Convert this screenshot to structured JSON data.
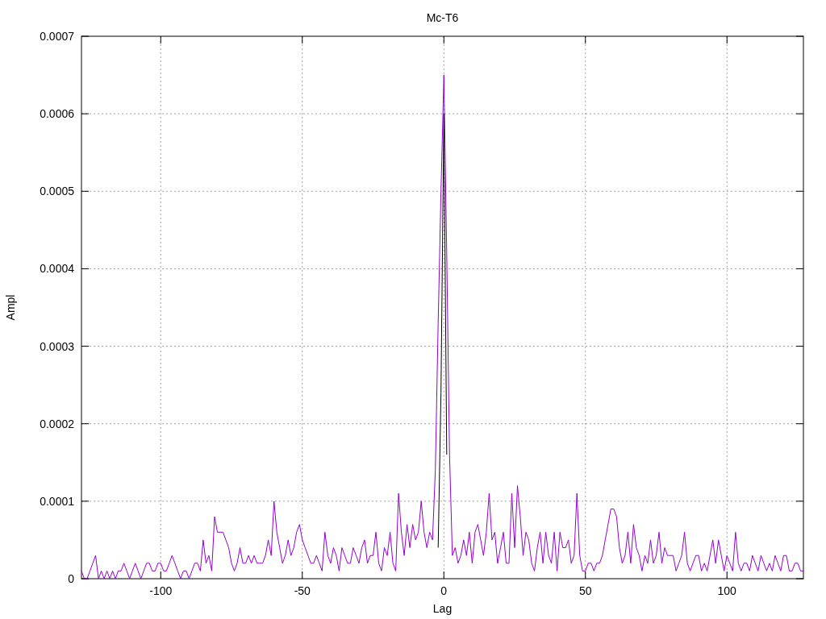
{
  "chart_data": {
    "type": "line",
    "title": "Mc-T6",
    "xlabel": "Lag",
    "ylabel": "Ampl",
    "grid": true,
    "xlim": [
      -128,
      127
    ],
    "ylim": [
      0,
      0.0007
    ],
    "xticks": [
      -100,
      -50,
      0,
      50,
      100
    ],
    "yticks": [
      {
        "value": 0,
        "label": "0"
      },
      {
        "value": 0.0001,
        "label": "0.0001"
      },
      {
        "value": 0.0002,
        "label": "0.0002"
      },
      {
        "value": 0.0003,
        "label": "0.0003"
      },
      {
        "value": 0.0004,
        "label": "0.0004"
      },
      {
        "value": 0.0005,
        "label": "0.0005"
      },
      {
        "value": 0.0006,
        "label": "0.0006"
      },
      {
        "value": 0.0007,
        "label": "0.0007"
      }
    ],
    "x": [
      -128,
      -127,
      -126,
      -125,
      -124,
      -123,
      -122,
      -121,
      -120,
      -119,
      -118,
      -117,
      -116,
      -115,
      -114,
      -113,
      -112,
      -111,
      -110,
      -109,
      -108,
      -107,
      -106,
      -105,
      -104,
      -103,
      -102,
      -101,
      -100,
      -99,
      -98,
      -97,
      -96,
      -95,
      -94,
      -93,
      -92,
      -91,
      -90,
      -89,
      -88,
      -87,
      -86,
      -85,
      -84,
      -83,
      -82,
      -81,
      -80,
      -79,
      -78,
      -77,
      -76,
      -75,
      -74,
      -73,
      -72,
      -71,
      -70,
      -69,
      -68,
      -67,
      -66,
      -65,
      -64,
      -63,
      -62,
      -61,
      -60,
      -59,
      -58,
      -57,
      -56,
      -55,
      -54,
      -53,
      -52,
      -51,
      -50,
      -49,
      -48,
      -47,
      -46,
      -45,
      -44,
      -43,
      -42,
      -41,
      -40,
      -39,
      -38,
      -37,
      -36,
      -35,
      -34,
      -33,
      -32,
      -31,
      -30,
      -29,
      -28,
      -27,
      -26,
      -25,
      -24,
      -23,
      -22,
      -21,
      -20,
      -19,
      -18,
      -17,
      -16,
      -15,
      -14,
      -13,
      -12,
      -11,
      -10,
      -9,
      -8,
      -7,
      -6,
      -5,
      -4,
      -3,
      -2,
      -1,
      0,
      1,
      2,
      3,
      4,
      5,
      6,
      7,
      8,
      9,
      10,
      11,
      12,
      13,
      14,
      15,
      16,
      17,
      18,
      19,
      20,
      21,
      22,
      23,
      24,
      25,
      26,
      27,
      28,
      29,
      30,
      31,
      32,
      33,
      34,
      35,
      36,
      37,
      38,
      39,
      40,
      41,
      42,
      43,
      44,
      45,
      46,
      47,
      48,
      49,
      50,
      51,
      52,
      53,
      54,
      55,
      56,
      57,
      58,
      59,
      60,
      61,
      62,
      63,
      64,
      65,
      66,
      67,
      68,
      69,
      70,
      71,
      72,
      73,
      74,
      75,
      76,
      77,
      78,
      79,
      80,
      81,
      82,
      83,
      84,
      85,
      86,
      87,
      88,
      89,
      90,
      91,
      92,
      93,
      94,
      95,
      96,
      97,
      98,
      99,
      100,
      101,
      102,
      103,
      104,
      105,
      106,
      107,
      108,
      109,
      110,
      111,
      112,
      113,
      114,
      115,
      116,
      117,
      118,
      119,
      120,
      121,
      122,
      123,
      124,
      125,
      126,
      127
    ],
    "series": [
      {
        "color": "#000000",
        "values": [
          null,
          null,
          null,
          null,
          null,
          null,
          null,
          null,
          null,
          null,
          null,
          null,
          null,
          null,
          null,
          null,
          null,
          null,
          null,
          null,
          null,
          null,
          null,
          null,
          null,
          null,
          null,
          null,
          null,
          null,
          null,
          null,
          null,
          null,
          null,
          null,
          null,
          null,
          null,
          null,
          null,
          null,
          null,
          null,
          null,
          null,
          null,
          null,
          null,
          null,
          null,
          null,
          null,
          null,
          null,
          null,
          null,
          null,
          null,
          null,
          null,
          null,
          null,
          null,
          null,
          null,
          null,
          null,
          null,
          null,
          null,
          null,
          null,
          null,
          null,
          null,
          null,
          null,
          null,
          null,
          null,
          null,
          null,
          null,
          null,
          null,
          null,
          null,
          null,
          null,
          null,
          null,
          null,
          null,
          null,
          null,
          null,
          null,
          null,
          null,
          null,
          null,
          null,
          null,
          null,
          null,
          null,
          null,
          null,
          null,
          null,
          null,
          null,
          null,
          null,
          null,
          null,
          null,
          null,
          null,
          null,
          null,
          null,
          null,
          null,
          null,
          4e-05,
          0.00024,
          0.0006,
          0.00016,
          null,
          null,
          null,
          null,
          null,
          null,
          null,
          null,
          null,
          null,
          null,
          null,
          null,
          null,
          null,
          null,
          null,
          null,
          null,
          null,
          null,
          null,
          null,
          null,
          null,
          null,
          null,
          null,
          null,
          null,
          null,
          null,
          null,
          null,
          null,
          null,
          null,
          null,
          null,
          null,
          null,
          null,
          null,
          null,
          null,
          null,
          null,
          null,
          null,
          null,
          null,
          null,
          null,
          null,
          null,
          null,
          null,
          null,
          null,
          null,
          null,
          null,
          null,
          null,
          null,
          null,
          null,
          null,
          null,
          null,
          null,
          null,
          null,
          null,
          null,
          null,
          null,
          null,
          null,
          null,
          null,
          null,
          null,
          null,
          null,
          null,
          null,
          null,
          null,
          null,
          null,
          null,
          null,
          null,
          null,
          null,
          null,
          null,
          null,
          null,
          null,
          null,
          null,
          null,
          null,
          null,
          null,
          null,
          null,
          null,
          null,
          null,
          null,
          null,
          null,
          null,
          null,
          null,
          null,
          null,
          null,
          null,
          null,
          null,
          null,
          null
        ]
      },
      {
        "color": "#9400d3",
        "values": [
          1e-05,
          0,
          0,
          1e-05,
          2e-05,
          3e-05,
          0,
          1e-05,
          0,
          1e-05,
          0,
          1e-05,
          0,
          1e-05,
          1e-05,
          2e-05,
          1e-05,
          0,
          1e-05,
          2e-05,
          1e-05,
          0,
          1e-05,
          2e-05,
          2e-05,
          1e-05,
          1e-05,
          2e-05,
          2e-05,
          1e-05,
          1e-05,
          2e-05,
          3e-05,
          2e-05,
          1e-05,
          0,
          1e-05,
          1e-05,
          0,
          1e-05,
          2e-05,
          2e-05,
          1e-05,
          5e-05,
          2e-05,
          3e-05,
          1e-05,
          8e-05,
          6e-05,
          6e-05,
          6e-05,
          5e-05,
          4e-05,
          2e-05,
          1e-05,
          2e-05,
          4e-05,
          2e-05,
          2e-05,
          3e-05,
          2e-05,
          3e-05,
          2e-05,
          2e-05,
          2e-05,
          3e-05,
          5e-05,
          3e-05,
          0.0001,
          6e-05,
          4e-05,
          2e-05,
          3e-05,
          5e-05,
          3e-05,
          4e-05,
          6e-05,
          7e-05,
          5e-05,
          4e-05,
          3e-05,
          2e-05,
          2e-05,
          3e-05,
          2e-05,
          1e-05,
          6e-05,
          3e-05,
          2e-05,
          4e-05,
          3e-05,
          1e-05,
          4e-05,
          3e-05,
          2e-05,
          2e-05,
          4e-05,
          3e-05,
          2e-05,
          4e-05,
          5e-05,
          2e-05,
          3e-05,
          3e-05,
          6e-05,
          2e-05,
          1e-05,
          4e-05,
          3e-05,
          6e-05,
          2e-05,
          1e-05,
          0.00011,
          6e-05,
          3e-05,
          7e-05,
          4e-05,
          7e-05,
          5e-05,
          6e-05,
          0.0001,
          6e-05,
          4e-05,
          6e-05,
          5e-05,
          0.00014,
          0.00033,
          0.0005,
          0.00065,
          0.00042,
          0.00016,
          3e-05,
          4e-05,
          2e-05,
          3e-05,
          5e-05,
          3e-05,
          6e-05,
          2e-05,
          6e-05,
          7e-05,
          5e-05,
          3e-05,
          6e-05,
          0.00011,
          5e-05,
          6e-05,
          2e-05,
          4e-05,
          6e-05,
          2e-05,
          2e-05,
          0.00011,
          4e-05,
          0.00012,
          8e-05,
          3e-05,
          6e-05,
          5e-05,
          2e-05,
          1e-05,
          4e-05,
          6e-05,
          2e-05,
          6e-05,
          3e-05,
          2e-05,
          6e-05,
          1e-05,
          6e-05,
          4e-05,
          4e-05,
          5e-05,
          2e-05,
          3e-05,
          0.00011,
          3e-05,
          1e-05,
          1e-05,
          2e-05,
          2e-05,
          1e-05,
          2e-05,
          2e-05,
          3e-05,
          5e-05,
          7e-05,
          9e-05,
          9e-05,
          8e-05,
          4e-05,
          2e-05,
          3e-05,
          6e-05,
          2e-05,
          7e-05,
          4e-05,
          3e-05,
          1e-05,
          3e-05,
          2e-05,
          5e-05,
          2e-05,
          3e-05,
          6e-05,
          2e-05,
          4e-05,
          3e-05,
          3e-05,
          3e-05,
          1e-05,
          2e-05,
          3e-05,
          6e-05,
          2e-05,
          1e-05,
          2e-05,
          3e-05,
          3e-05,
          1e-05,
          2e-05,
          1e-05,
          3e-05,
          5e-05,
          2e-05,
          5e-05,
          3e-05,
          1e-05,
          3e-05,
          2e-05,
          1e-05,
          6e-05,
          2e-05,
          1e-05,
          2e-05,
          2e-05,
          1e-05,
          3e-05,
          2e-05,
          1e-05,
          3e-05,
          2e-05,
          1e-05,
          2e-05,
          1e-05,
          3e-05,
          2e-05,
          1e-05,
          3e-05,
          3e-05,
          1e-05,
          1e-05,
          2e-05,
          2e-05,
          1e-05,
          1e-05
        ]
      }
    ]
  }
}
